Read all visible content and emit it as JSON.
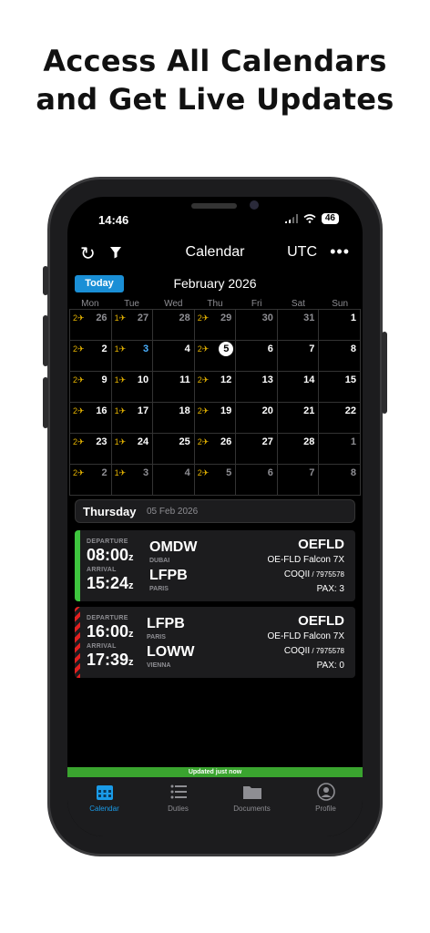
{
  "headline": {
    "line1": "Access All Calendars",
    "line2": "and Get Live Updates"
  },
  "status_bar": {
    "time": "14:46",
    "battery": "46"
  },
  "topbar": {
    "title": "Calendar",
    "timezone": "UTC",
    "more": "•••"
  },
  "calendar": {
    "today_label": "Today",
    "month": "February 2026",
    "weekdays": [
      "Mon",
      "Tue",
      "Wed",
      "Thu",
      "Fri",
      "Sat",
      "Sun"
    ],
    "cells": [
      {
        "c": "2✈",
        "d": "26",
        "m": true
      },
      {
        "c": "1✈",
        "d": "27",
        "m": true
      },
      {
        "c": "",
        "d": "28",
        "m": true
      },
      {
        "c": "2✈",
        "d": "29",
        "m": true
      },
      {
        "c": "",
        "d": "30",
        "m": true
      },
      {
        "c": "",
        "d": "31",
        "m": true
      },
      {
        "c": "",
        "d": "1"
      },
      {
        "c": "2✈",
        "d": "2"
      },
      {
        "c": "1✈",
        "d": "3",
        "b": true
      },
      {
        "c": "",
        "d": "4"
      },
      {
        "c": "2✈",
        "d": "5",
        "t": true
      },
      {
        "c": "",
        "d": "6"
      },
      {
        "c": "",
        "d": "7"
      },
      {
        "c": "",
        "d": "8"
      },
      {
        "c": "2✈",
        "d": "9"
      },
      {
        "c": "1✈",
        "d": "10"
      },
      {
        "c": "",
        "d": "11"
      },
      {
        "c": "2✈",
        "d": "12"
      },
      {
        "c": "",
        "d": "13"
      },
      {
        "c": "",
        "d": "14"
      },
      {
        "c": "",
        "d": "15"
      },
      {
        "c": "2✈",
        "d": "16"
      },
      {
        "c": "1✈",
        "d": "17"
      },
      {
        "c": "",
        "d": "18"
      },
      {
        "c": "2✈",
        "d": "19"
      },
      {
        "c": "",
        "d": "20"
      },
      {
        "c": "",
        "d": "21"
      },
      {
        "c": "",
        "d": "22"
      },
      {
        "c": "2✈",
        "d": "23"
      },
      {
        "c": "1✈",
        "d": "24"
      },
      {
        "c": "",
        "d": "25"
      },
      {
        "c": "2✈",
        "d": "26"
      },
      {
        "c": "",
        "d": "27"
      },
      {
        "c": "",
        "d": "28"
      },
      {
        "c": "",
        "d": "1",
        "m": true
      },
      {
        "c": "2✈",
        "d": "2",
        "m": true
      },
      {
        "c": "1✈",
        "d": "3",
        "m": true
      },
      {
        "c": "",
        "d": "4",
        "m": true
      },
      {
        "c": "2✈",
        "d": "5",
        "m": true
      },
      {
        "c": "",
        "d": "6",
        "m": true
      },
      {
        "c": "",
        "d": "7",
        "m": true
      },
      {
        "c": "",
        "d": "8",
        "m": true
      }
    ]
  },
  "day_header": {
    "day": "Thursday",
    "date": "05 Feb 2026"
  },
  "flights": [
    {
      "dep_label": "DEPARTURE",
      "dep_time": "08:00",
      "arr_label": "ARRIVAL",
      "arr_time": "15:24",
      "zone": "z",
      "from": "OMDW",
      "from_city": "DUBAI",
      "to": "LFPB",
      "to_city": "PARIS",
      "reg": "OEFLD",
      "aircraft": "OE-FLD Falcon 7X",
      "crew": "COQII",
      "crew_id": " / 7975578",
      "pax": "PAX: 3",
      "status_color": "#3ec53e"
    },
    {
      "dep_label": "DEPARTURE",
      "dep_time": "16:00",
      "arr_label": "ARRIVAL",
      "arr_time": "17:39",
      "zone": "z",
      "from": "LFPB",
      "from_city": "PARIS",
      "to": "LOWW",
      "to_city": "VIENNA",
      "reg": "OEFLD",
      "aircraft": "OE-FLD Falcon 7X",
      "crew": "COQII",
      "crew_id": " / 7975578",
      "pax": "PAX: 0",
      "status_color": "#e02020"
    }
  ],
  "updated_banner": "Updated just now",
  "tabs": [
    {
      "label": "Calendar",
      "icon": "calendar-icon",
      "active": true
    },
    {
      "label": "Duties",
      "icon": "list-icon"
    },
    {
      "label": "Documents",
      "icon": "folder-icon"
    },
    {
      "label": "Profile",
      "icon": "person-icon"
    }
  ],
  "colors": {
    "accent": "#1a9be8",
    "flight_count": "#e6b400",
    "updated_banner": "#3aa42f"
  }
}
